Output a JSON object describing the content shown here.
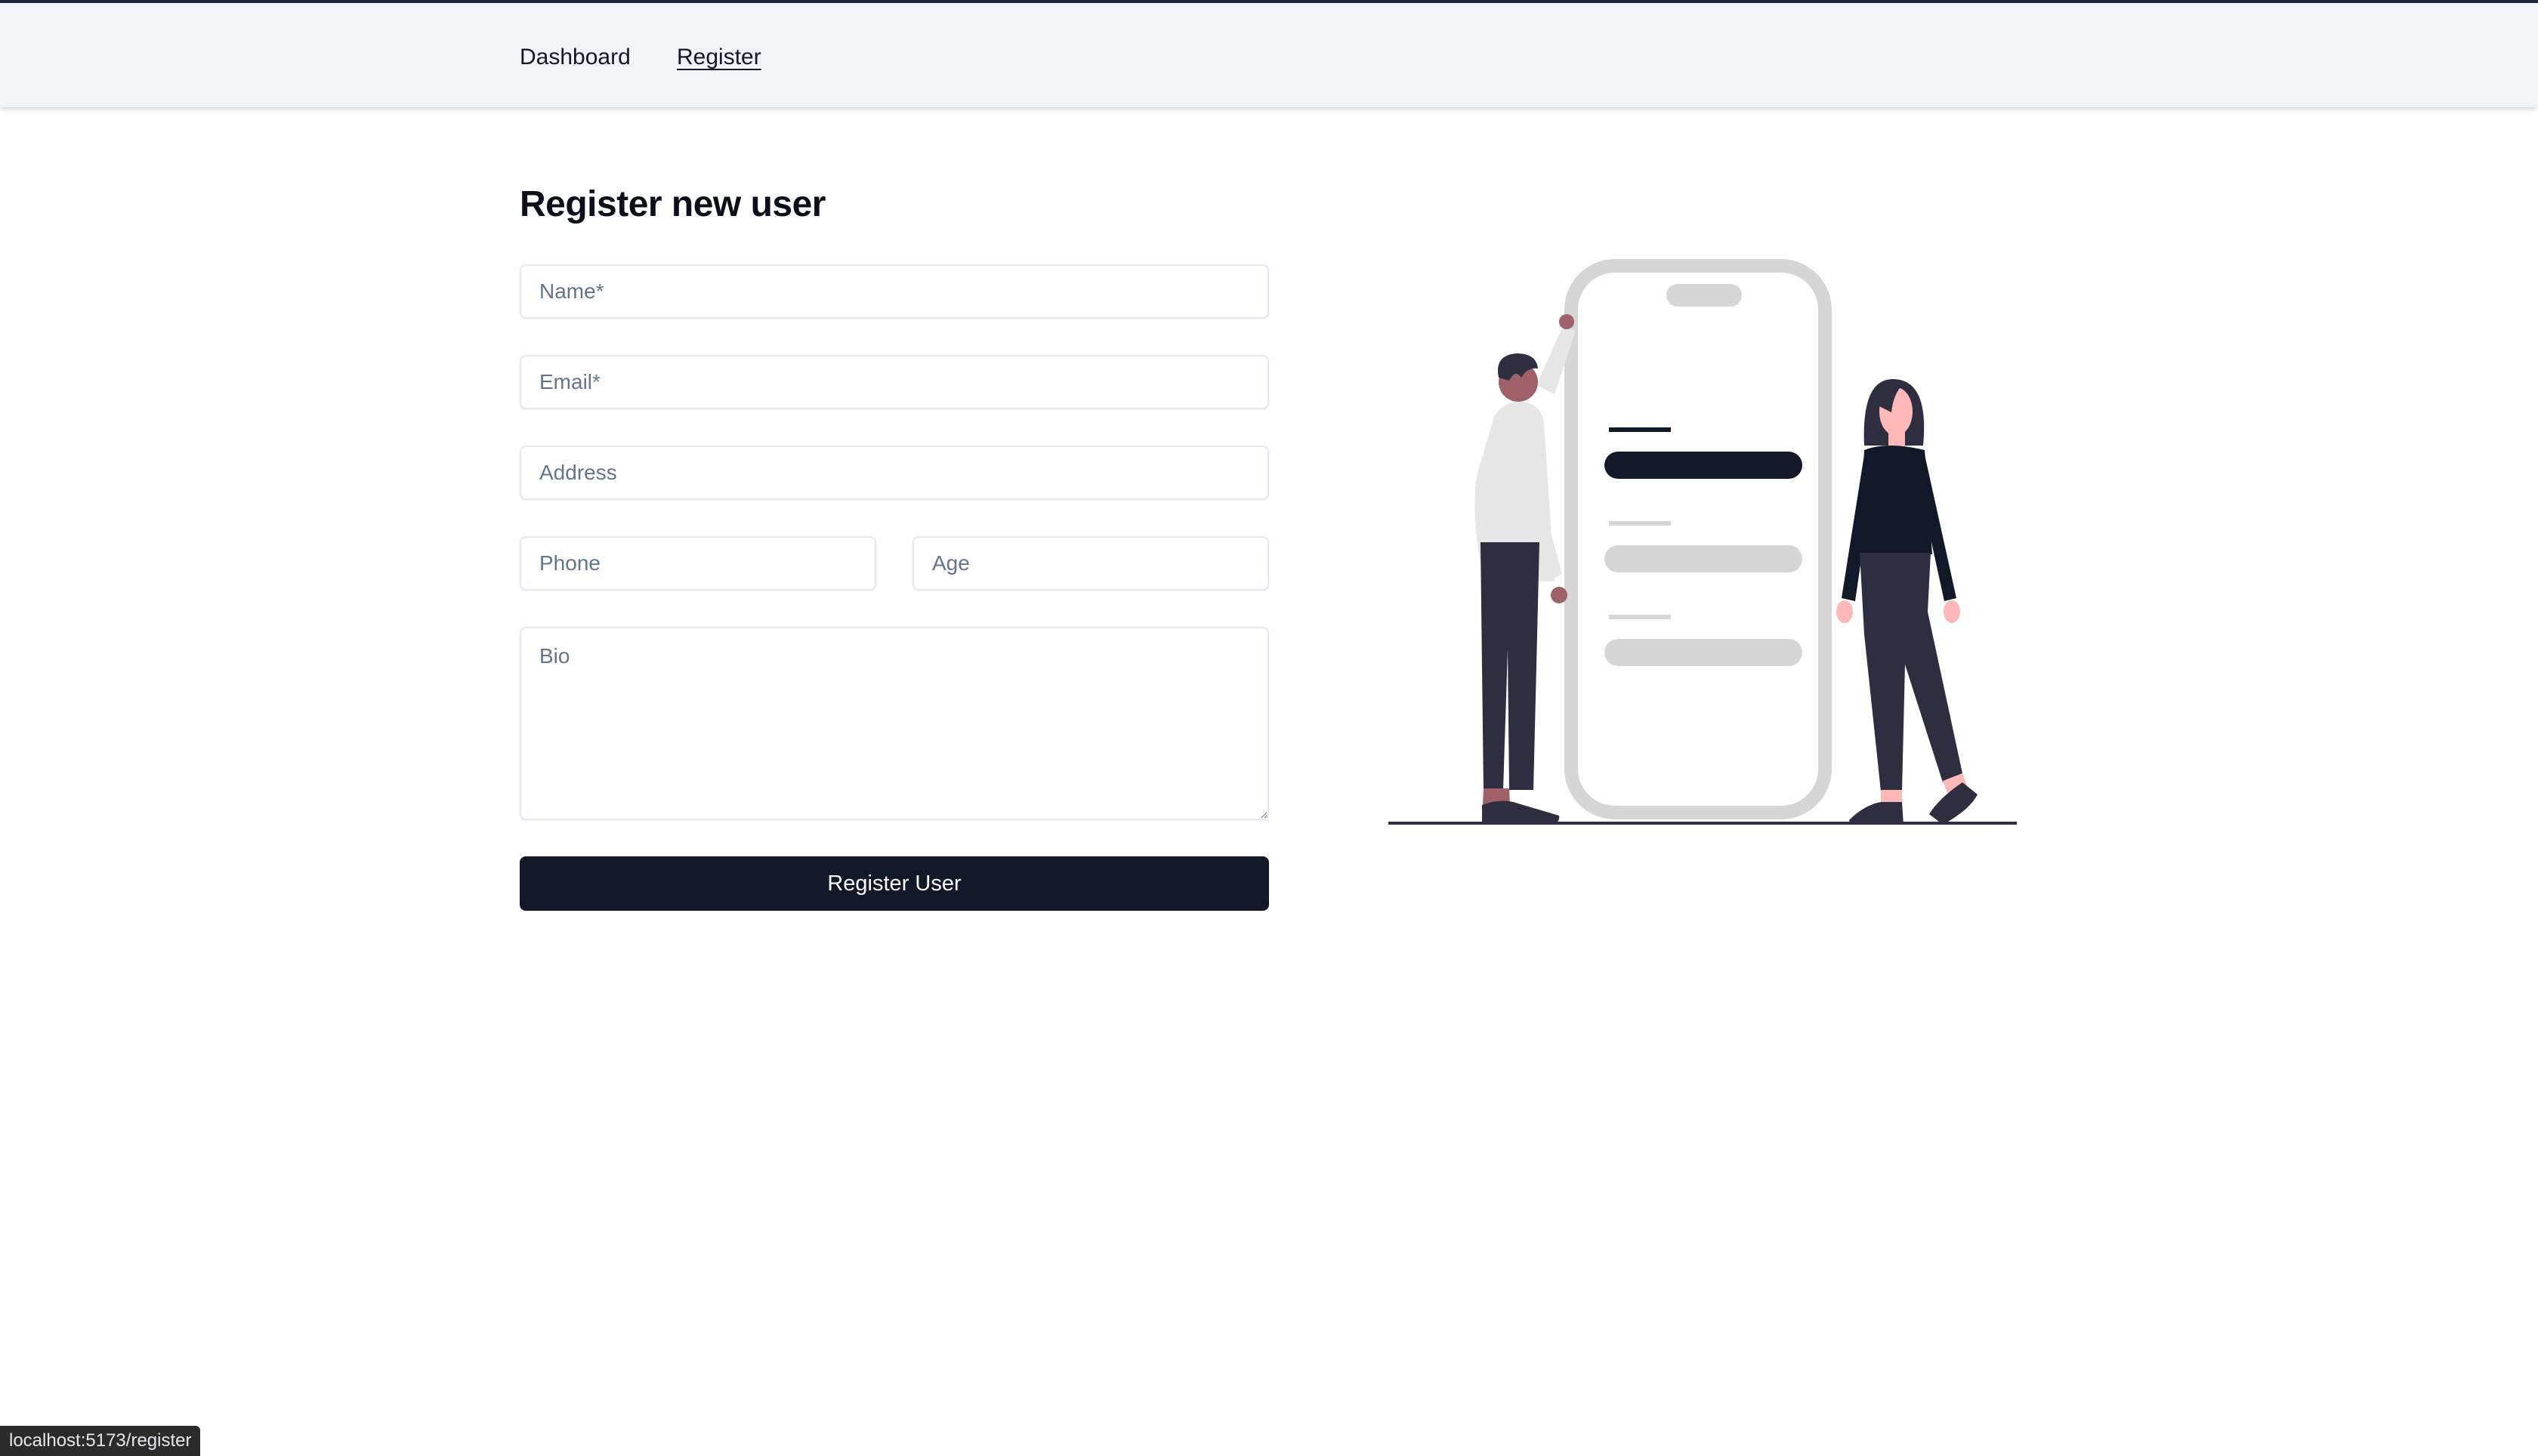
{
  "nav": {
    "items": [
      {
        "label": "Dashboard",
        "active": false
      },
      {
        "label": "Register",
        "active": true
      }
    ]
  },
  "page": {
    "title": "Register new user"
  },
  "form": {
    "name_placeholder": "Name*",
    "email_placeholder": "Email*",
    "address_placeholder": "Address",
    "phone_placeholder": "Phone",
    "age_placeholder": "Age",
    "bio_placeholder": "Bio",
    "submit_label": "Register User"
  },
  "illustration": {
    "name": "two-people-with-phone-illustration"
  },
  "status_bar": {
    "url": "localhost:5173/register"
  },
  "colors": {
    "primary": "#111827",
    "nav_background": "#f1f5f9",
    "border": "#e2e8f0",
    "placeholder": "#64748b"
  }
}
